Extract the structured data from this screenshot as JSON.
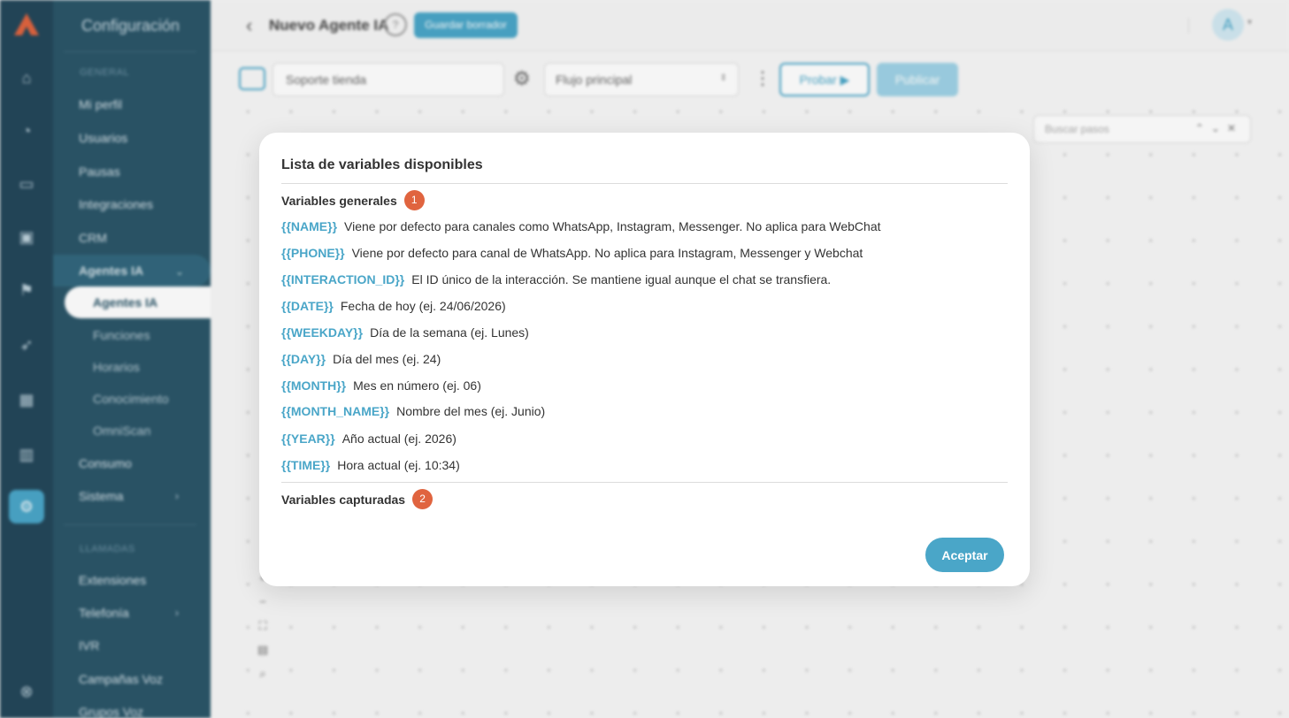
{
  "sidebar": {
    "title": "Configuración",
    "section_general": "GENERAL",
    "items": {
      "mi_perfil": "Mi perfil",
      "usuarios": "Usuarios",
      "pausas": "Pausas",
      "integraciones": "Integraciones",
      "crm": "CRM",
      "agentes_ia": "Agentes IA",
      "consumo": "Consumo",
      "sistema": "Sistema"
    },
    "subitems": {
      "agentes_ia": "Agentes IA",
      "funciones": "Funciones",
      "horarios": "Horarios",
      "conocimiento": "Conocimiento",
      "omniscan": "OmniScan"
    },
    "section_llamadas": "LLAMADAS",
    "llamadas_items": {
      "extensiones": "Extensiones",
      "telefonia": "Telefonía",
      "ivr": "IVR",
      "campanas_voz": "Campañas Voz",
      "grupos_voz": "Grupos Voz"
    }
  },
  "header": {
    "title": "Nuevo Agente IA",
    "help": "?",
    "draft_button": "Guardar borrador",
    "avatar_initial": "A"
  },
  "toolbar": {
    "agent_name": "Soporte tienda",
    "flow_selected": "Flujo principal",
    "try_button": "Probar ▶",
    "publish_button": "Publicar"
  },
  "canvas": {
    "search_placeholder": "Buscar pasos"
  },
  "modal": {
    "title": "Lista de variables disponibles",
    "general_section": "Variables generales",
    "general_badge": "1",
    "variables": [
      {
        "key": "{{NAME}}",
        "desc": "Viene por defecto para canales como WhatsApp, Instagram, Messenger. No aplica para WebChat"
      },
      {
        "key": "{{PHONE}}",
        "desc": "Viene por defecto para canal de WhatsApp. No aplica para Instagram, Messenger y Webchat"
      },
      {
        "key": "{{INTERACTION_ID}}",
        "desc": "El ID único de la interacción. Se mantiene igual aunque el chat se transfiera."
      },
      {
        "key": "{{DATE}}",
        "desc": "Fecha de hoy (ej. 24/06/2026)"
      },
      {
        "key": "{{WEEKDAY}}",
        "desc": "Día de la semana (ej. Lunes)"
      },
      {
        "key": "{{DAY}}",
        "desc": "Día del mes (ej. 24)"
      },
      {
        "key": "{{MONTH}}",
        "desc": "Mes en número (ej. 06)"
      },
      {
        "key": "{{MONTH_NAME}}",
        "desc": "Nombre del mes (ej. Junio)"
      },
      {
        "key": "{{YEAR}}",
        "desc": "Año actual (ej. 2026)"
      },
      {
        "key": "{{TIME}}",
        "desc": "Hora actual (ej. 10:34)"
      }
    ],
    "captured_section": "Variables capturadas",
    "captured_badge": "2",
    "accept_button": "Aceptar"
  },
  "colors": {
    "accent": "#4aa6c8",
    "sidebar": "#2b5669",
    "badge": "#e0643f"
  }
}
